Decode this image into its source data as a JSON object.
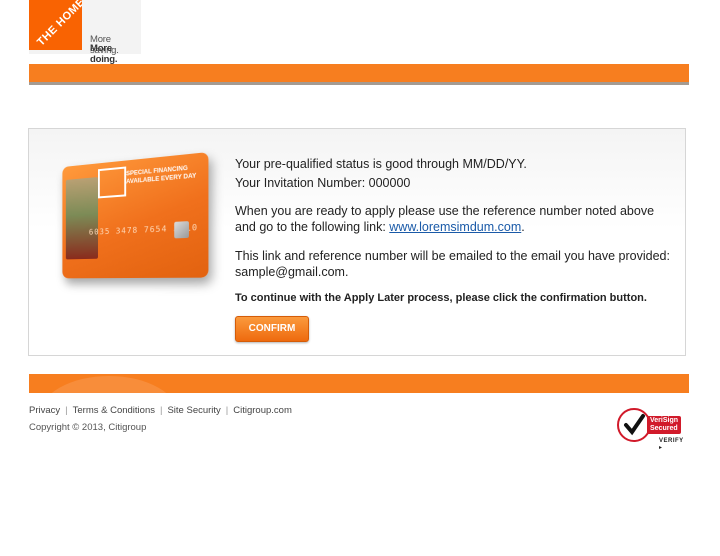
{
  "header": {
    "logo_text": "THE HOME DEPOT",
    "tagline_line1": "More saving.",
    "tagline_line2": "More doing."
  },
  "card": {
    "text_line1": "SPECIAL FINANCING",
    "text_line2": "AVAILABLE EVERY DAY",
    "number": "6035 3478 7654 3210"
  },
  "content": {
    "status_text": "Your pre-qualified status is good through MM/DD/YY.",
    "invitation_label": "Your Invitation Number: 000000",
    "apply_text": "When you are ready to apply please use the reference number noted above and go to the following link: ",
    "apply_link": "www.loremsimdum.com",
    "apply_period": ".",
    "email_text": "This link and reference number will be emailed to the email you have provided: sample@gmail.com.",
    "instruction": "To continue with the Apply Later process, please click the confirmation button.",
    "confirm_label": "CONFIRM"
  },
  "footer": {
    "links": [
      "Privacy",
      "Terms & Conditions",
      "Site Security",
      "Citigroup.com"
    ],
    "copyright": "Copyright © 2013, Citigroup",
    "badge_label_line1": "VeriSign",
    "badge_label_line2": "Secured",
    "badge_verify": "VERIFY ▸"
  },
  "colors": {
    "brand_orange": "#f96302",
    "band_orange": "#f77e1f",
    "link_blue": "#1a5aa8"
  }
}
